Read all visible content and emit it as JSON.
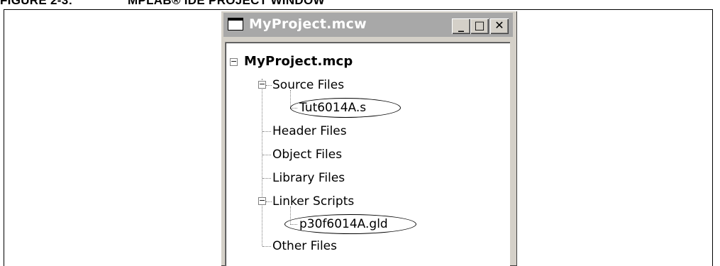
{
  "figure": {
    "number": "FIGURE 2-3:",
    "title": "MPLAB® IDE PROJECT WINDOW"
  },
  "window": {
    "title": "MyProject.mcw",
    "buttons": {
      "minimize_glyph": "_",
      "maximize_glyph": "□",
      "close_glyph": "✕"
    }
  },
  "tree": {
    "root": {
      "label": "MyProject.mcp",
      "expanded": true,
      "expander_glyph": "−"
    },
    "folders": [
      {
        "label": "Source Files",
        "expanded": true,
        "expander_glyph": "−",
        "children": [
          "Tut6014A.s"
        ]
      },
      {
        "label": "Header Files",
        "expanded": false,
        "children": []
      },
      {
        "label": "Object Files",
        "expanded": false,
        "children": []
      },
      {
        "label": "Library Files",
        "expanded": false,
        "children": []
      },
      {
        "label": "Linker Scripts",
        "expanded": true,
        "expander_glyph": "−",
        "children": [
          "p30f6014A.gld"
        ]
      },
      {
        "label": "Other Files",
        "expanded": false,
        "children": []
      }
    ]
  },
  "highlights": {
    "note": "",
    "circled_items": []
  }
}
